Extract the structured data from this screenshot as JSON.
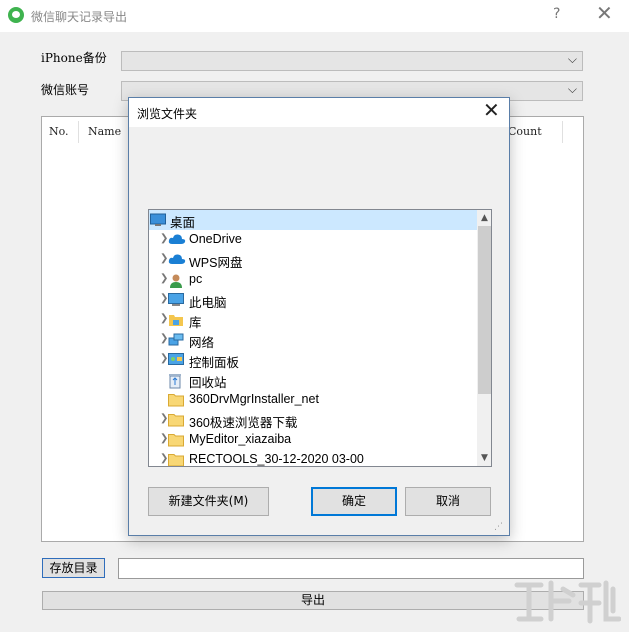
{
  "window": {
    "title": "微信聊天记录导出",
    "help_label": "?",
    "close_label": "✕"
  },
  "form": {
    "backup_label": "iPhone备份",
    "account_label": "微信账号",
    "backup_value": "",
    "account_value": ""
  },
  "list": {
    "columns": [
      "No.",
      "Name",
      "Count"
    ]
  },
  "bottom": {
    "dir_button": "存放目录",
    "dir_value": "",
    "export_button": "导出"
  },
  "dialog": {
    "title": "浏览文件夹",
    "close_label": "✕",
    "tree": [
      {
        "label": "桌面",
        "icon": "desktop-icon",
        "expandable": false,
        "selected": true,
        "level": 0
      },
      {
        "label": "OneDrive",
        "icon": "cloud-icon",
        "expandable": true,
        "selected": false,
        "level": 1
      },
      {
        "label": "WPS网盘",
        "icon": "cloud-icon",
        "expandable": true,
        "selected": false,
        "level": 1
      },
      {
        "label": "pc",
        "icon": "user-icon",
        "expandable": true,
        "selected": false,
        "level": 1
      },
      {
        "label": "此电脑",
        "icon": "computer-icon",
        "expandable": true,
        "selected": false,
        "level": 1
      },
      {
        "label": "库",
        "icon": "library-icon",
        "expandable": true,
        "selected": false,
        "level": 1
      },
      {
        "label": "网络",
        "icon": "network-icon",
        "expandable": true,
        "selected": false,
        "level": 1
      },
      {
        "label": "控制面板",
        "icon": "control-panel-icon",
        "expandable": true,
        "selected": false,
        "level": 1
      },
      {
        "label": "回收站",
        "icon": "recycle-bin-icon",
        "expandable": false,
        "selected": false,
        "level": 1
      },
      {
        "label": "360DrvMgrInstaller_net",
        "icon": "folder-icon",
        "expandable": false,
        "selected": false,
        "level": 1
      },
      {
        "label": "360极速浏览器下载",
        "icon": "folder-icon",
        "expandable": true,
        "selected": false,
        "level": 1
      },
      {
        "label": "MyEditor_xiazaiba",
        "icon": "folder-icon",
        "expandable": true,
        "selected": false,
        "level": 1
      },
      {
        "label": "RECTOOLS_30-12-2020 03-00",
        "icon": "folder-icon",
        "expandable": true,
        "selected": false,
        "level": 1
      }
    ],
    "new_folder_button": "新建文件夹(M)",
    "ok_button": "确定",
    "cancel_button": "取消"
  },
  "colors": {
    "accent": "#0078d7",
    "selection": "#cce8ff",
    "app_icon": "#3fb34f"
  }
}
